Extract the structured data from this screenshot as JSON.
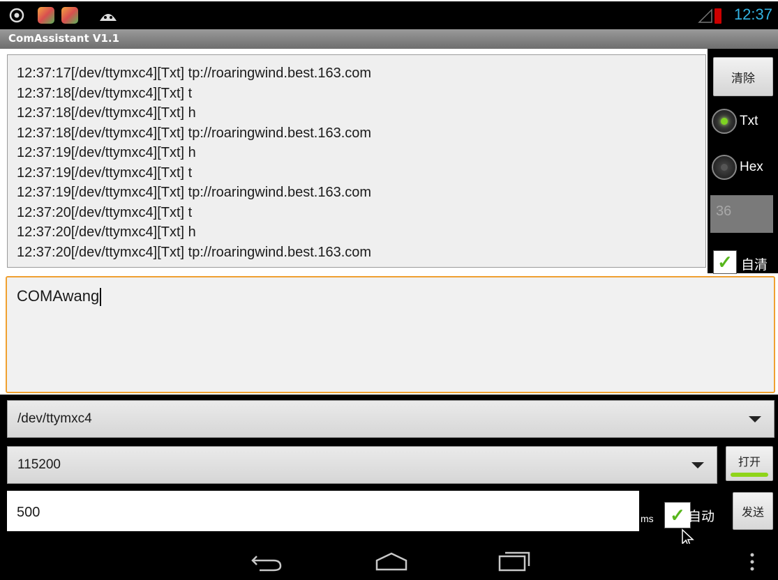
{
  "status_bar": {
    "time": "12:37",
    "colors": {
      "clock": "#33b5e5",
      "battery_alert": "#cc0000"
    },
    "icons": [
      "usb-debug-icon",
      "app-icon",
      "app-icon",
      "android-icon",
      "signal-icon",
      "battery-alert-icon"
    ]
  },
  "app": {
    "title": "ComAssistant V1.1"
  },
  "log": {
    "lines": [
      "12:37:17[/dev/ttymxc4][Txt] tp://roaringwind.best.163.com",
      "12:37:18[/dev/ttymxc4][Txt] t",
      "12:37:18[/dev/ttymxc4][Txt] h",
      "12:37:18[/dev/ttymxc4][Txt] tp://roaringwind.best.163.com",
      "12:37:19[/dev/ttymxc4][Txt] h",
      "12:37:19[/dev/ttymxc4][Txt] t",
      "12:37:19[/dev/ttymxc4][Txt] tp://roaringwind.best.163.com",
      "12:37:20[/dev/ttymxc4][Txt] t",
      "12:37:20[/dev/ttymxc4][Txt] h",
      "12:37:20[/dev/ttymxc4][Txt] tp://roaringwind.best.163.com"
    ]
  },
  "controls": {
    "clear_label": "清除",
    "txt_label": "Txt",
    "hex_label": "Hex",
    "line_count": "36",
    "auto_clear_label": "自清",
    "auto_clear_checked": true,
    "selected_mode": "Txt"
  },
  "send_box": {
    "value": "COMAwang"
  },
  "port": {
    "selected": "/dev/ttymxc4"
  },
  "baud": {
    "selected": "115200"
  },
  "open_button": {
    "label": "打开",
    "indicator_color": "#8fd41a"
  },
  "interval": {
    "value": "500",
    "unit": "ms"
  },
  "auto_send": {
    "label": "自动",
    "checked": true
  },
  "send_button": {
    "label": "发送"
  },
  "accent_colors": {
    "focus_border": "#f0a030",
    "radio_on": "#7ed321",
    "check": "#57b61c"
  }
}
